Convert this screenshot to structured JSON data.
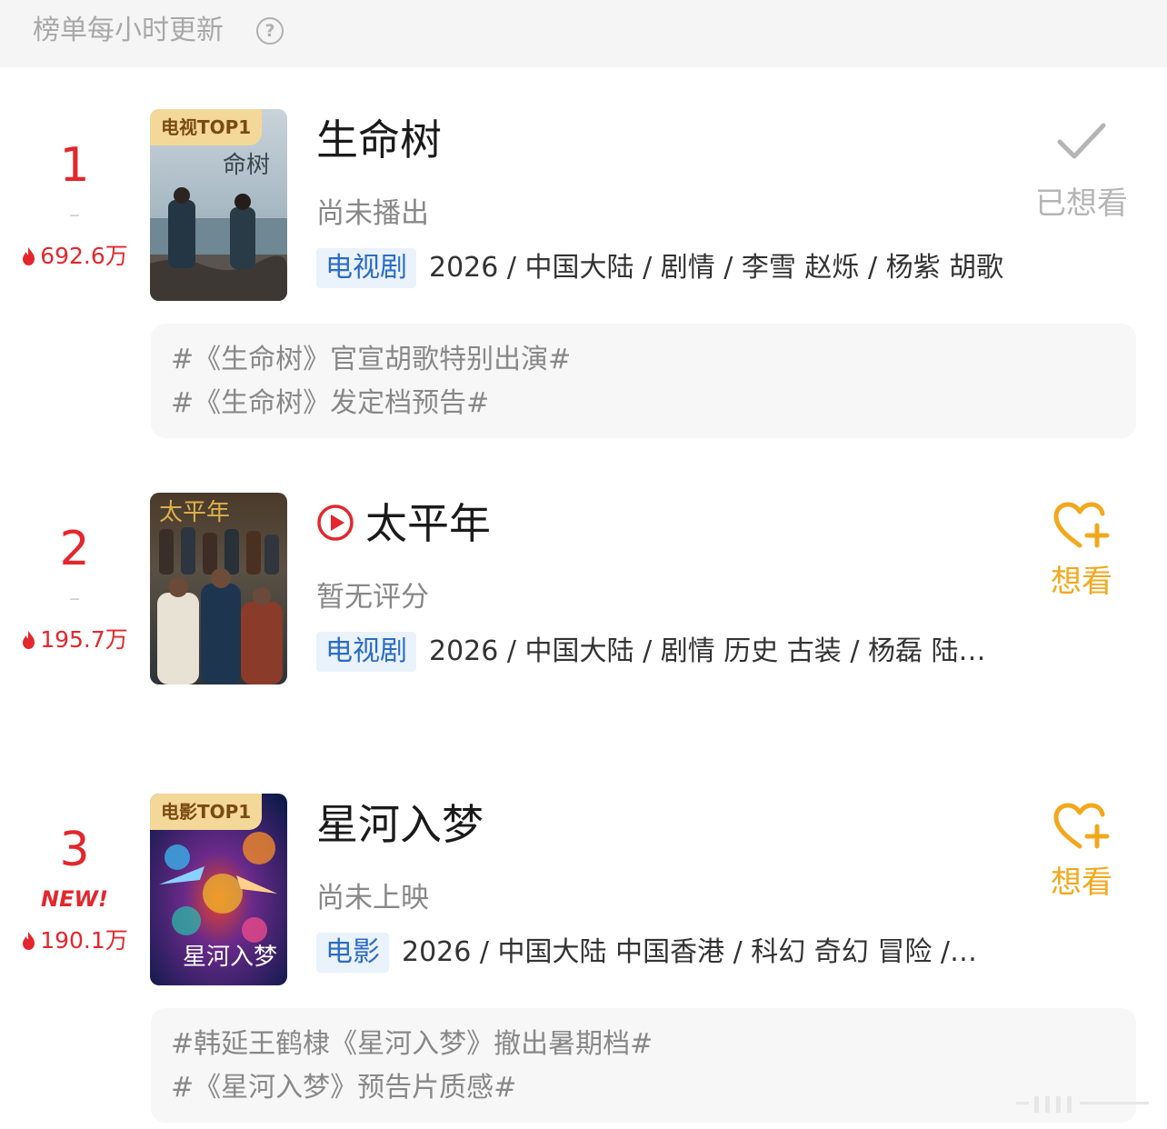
{
  "header": {
    "note": "榜单每小时更新",
    "help_icon": "question-circle-icon"
  },
  "colors": {
    "rank": "#e3272d",
    "type_tag_bg": "#eaf2fc",
    "type_tag_text": "#2b6cc4",
    "want_orange": "#f2a81d",
    "done_gray": "#b5b5b5"
  },
  "items": [
    {
      "rank": "1",
      "trend": "–",
      "heat": "692.6万",
      "poster_badge": "电视TOP1",
      "title": "生命树",
      "status": "尚未播出",
      "type": "电视剧",
      "meta": "2026 / 中国大陆 / 剧情 / 李雪 赵烁 / 杨紫 胡歌",
      "action_label": "已想看",
      "action_icon": "checkmark-icon",
      "topics": [
        "#《生命树》官宣胡歌特别出演#",
        "#《生命树》发定档预告#"
      ]
    },
    {
      "rank": "2",
      "trend": "–",
      "heat": "195.7万",
      "title": "太平年",
      "title_icon": "play-circle-icon",
      "status": "暂无评分",
      "type": "电视剧",
      "meta": "2026 / 中国大陆 / 剧情 历史 古装 / 杨磊 陆…",
      "action_label": "想看",
      "action_icon": "heart-plus-icon"
    },
    {
      "rank": "3",
      "new_tag": "NEW!",
      "heat": "190.1万",
      "poster_badge": "电影TOP1",
      "title": "星河入梦",
      "status": "尚未上映",
      "type": "电影",
      "meta": "2026 / 中国大陆 中国香港 / 科幻 奇幻 冒险 /…",
      "action_label": "想看",
      "action_icon": "heart-plus-icon",
      "topics": [
        "#韩延王鹤棣《星河入梦》撤出暑期档#",
        "#《星河入梦》预告片质感#"
      ]
    }
  ]
}
